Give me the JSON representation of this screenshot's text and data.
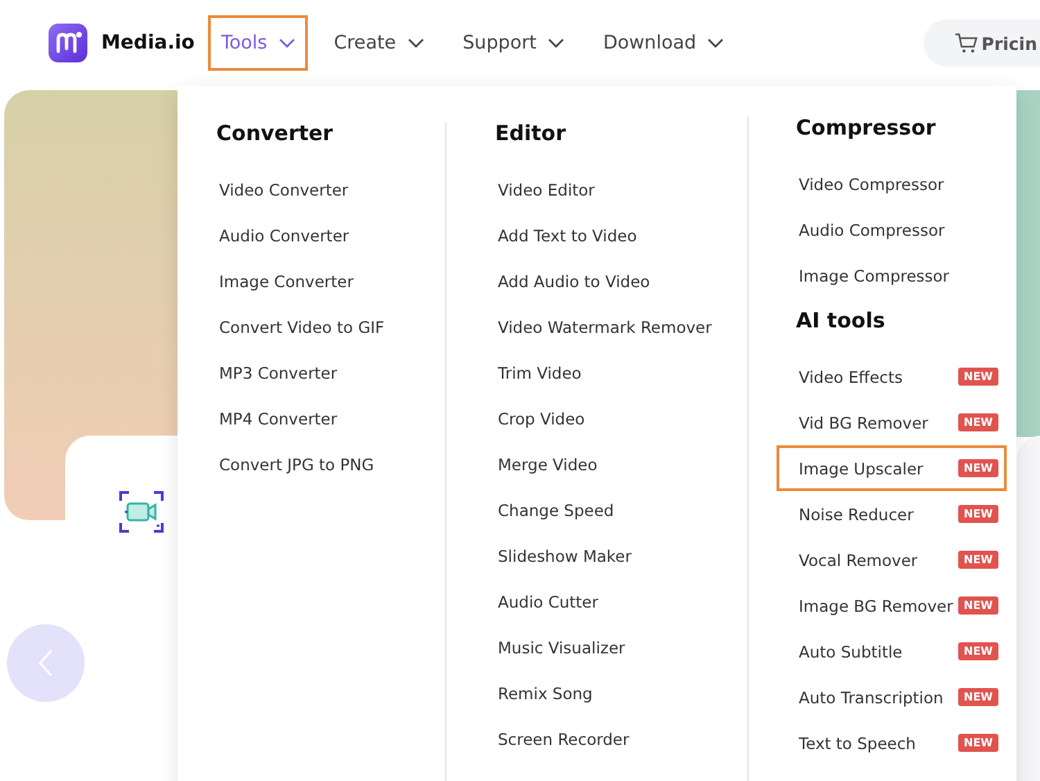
{
  "header": {
    "brand": "Media.io",
    "nav": [
      {
        "label": "Tools",
        "selected": true
      },
      {
        "label": "Create",
        "selected": false
      },
      {
        "label": "Support",
        "selected": false
      },
      {
        "label": "Download",
        "selected": false
      }
    ],
    "pricing": "Pricin"
  },
  "menu": {
    "columns": [
      {
        "sections": [
          {
            "title": "Converter",
            "items": [
              {
                "label": "Video Converter",
                "selected": false
              },
              {
                "label": "Audio Converter",
                "selected": false
              },
              {
                "label": "Image Converter",
                "selected": false
              },
              {
                "label": "Convert Video to GIF",
                "selected": false
              },
              {
                "label": "MP3 Converter",
                "selected": false
              },
              {
                "label": "MP4 Converter",
                "selected": false
              },
              {
                "label": "Convert JPG to PNG",
                "selected": false
              }
            ]
          }
        ]
      },
      {
        "sections": [
          {
            "title": "Editor",
            "items": [
              {
                "label": "Video Editor",
                "selected": false
              },
              {
                "label": "Add Text to Video",
                "selected": false
              },
              {
                "label": "Add Audio to Video",
                "selected": false
              },
              {
                "label": "Video Watermark Remover",
                "selected": false
              },
              {
                "label": "Trim Video",
                "selected": false
              },
              {
                "label": "Crop Video",
                "selected": false
              },
              {
                "label": "Merge Video",
                "selected": false
              },
              {
                "label": "Change Speed",
                "selected": false
              },
              {
                "label": "Slideshow Maker",
                "selected": false
              },
              {
                "label": "Audio Cutter",
                "selected": false
              },
              {
                "label": "Music Visualizer",
                "selected": false
              },
              {
                "label": "Remix Song",
                "selected": false
              },
              {
                "label": "Screen Recorder",
                "selected": false
              }
            ]
          }
        ]
      },
      {
        "sections": [
          {
            "title": "Compressor",
            "items": [
              {
                "label": "Video Compressor",
                "selected": false
              },
              {
                "label": "Audio Compressor",
                "selected": false
              },
              {
                "label": "Image Compressor",
                "selected": false
              }
            ]
          },
          {
            "title": "AI tools",
            "items": [
              {
                "label": "Video Effects",
                "badge": "NEW",
                "selected": false
              },
              {
                "label": "Vid BG Remover",
                "badge": "NEW",
                "selected": false
              },
              {
                "label": "Image Upscaler",
                "badge": "NEW",
                "selected": true
              },
              {
                "label": "Noise Reducer",
                "badge": "NEW",
                "selected": false
              },
              {
                "label": "Vocal Remover",
                "badge": "NEW",
                "selected": false
              },
              {
                "label": "Image BG Remover",
                "badge": "NEW",
                "selected": false
              },
              {
                "label": "Auto Subtitle",
                "badge": "NEW",
                "selected": false
              },
              {
                "label": "Auto Transcription",
                "badge": "NEW",
                "selected": false
              },
              {
                "label": "Text to Speech",
                "badge": "NEW",
                "selected": false
              }
            ]
          }
        ]
      }
    ]
  }
}
